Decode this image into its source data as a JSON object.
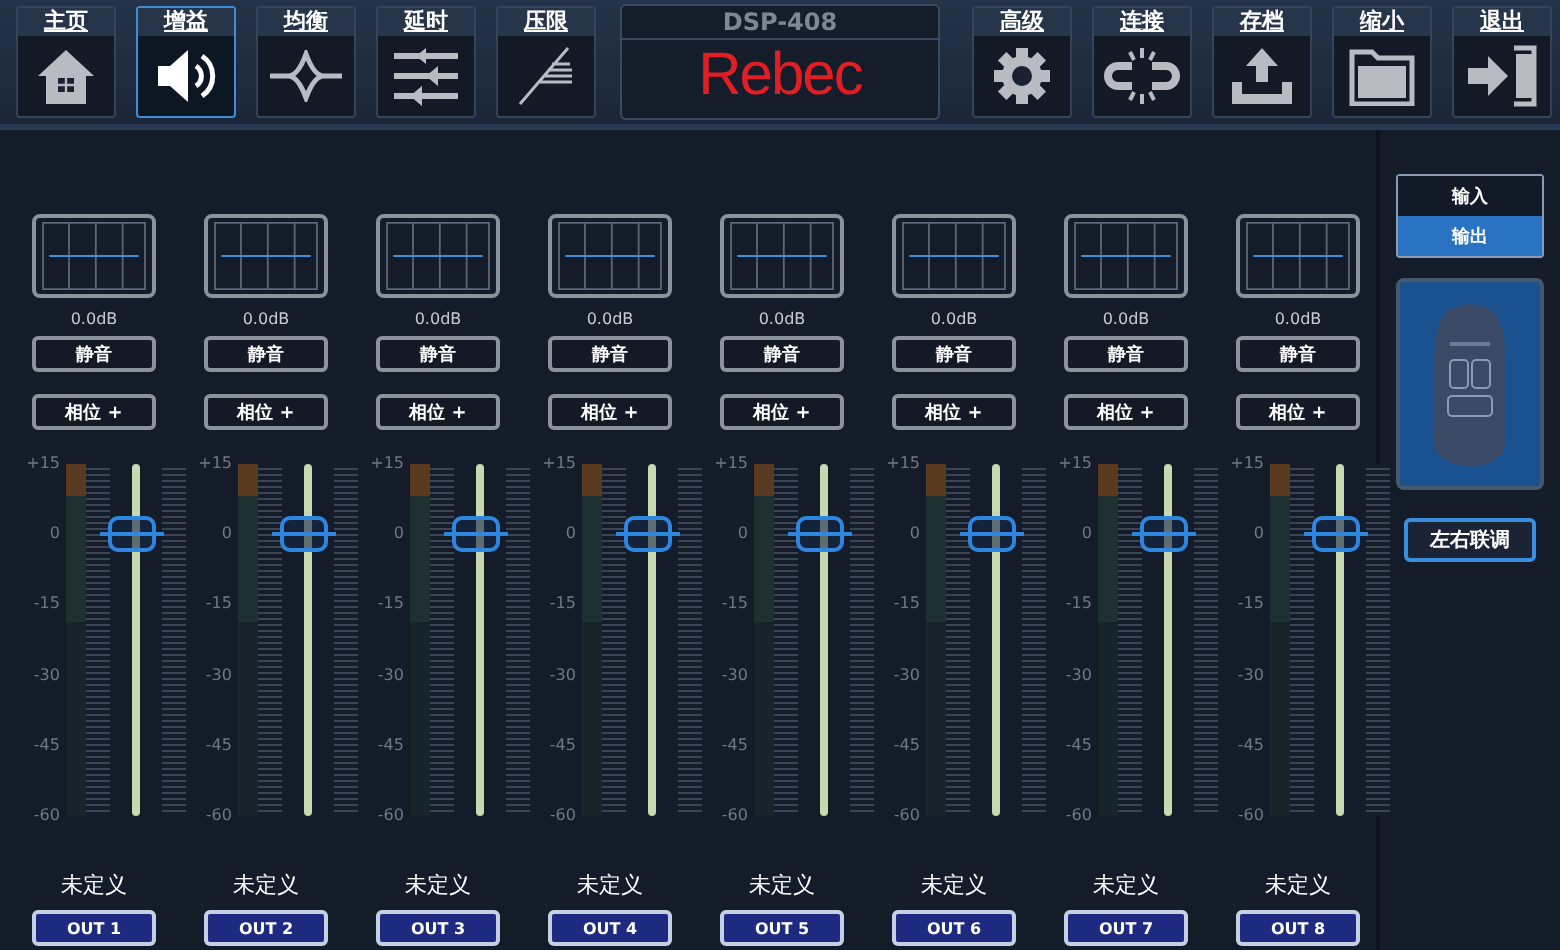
{
  "nav_left": [
    {
      "label": "主页",
      "kind": "home",
      "selected": false
    },
    {
      "label": "增益",
      "kind": "speaker",
      "selected": true
    },
    {
      "label": "均衡",
      "kind": "eq",
      "selected": false
    },
    {
      "label": "延时",
      "kind": "delay",
      "selected": false
    },
    {
      "label": "压限",
      "kind": "limiter",
      "selected": false
    }
  ],
  "device": {
    "model": "DSP-408",
    "brand": "Rebec"
  },
  "nav_right": [
    {
      "label": "高级",
      "kind": "gear",
      "selected": false
    },
    {
      "label": "连接",
      "kind": "link",
      "selected": false
    },
    {
      "label": "存档",
      "kind": "upload",
      "selected": false
    },
    {
      "label": "缩小",
      "kind": "folder",
      "selected": false
    },
    {
      "label": "退出",
      "kind": "exit",
      "selected": false
    }
  ],
  "channels": [
    {
      "gain": "0.0dB",
      "mute": "静音",
      "phase": "相位 +",
      "scale": [
        "+15",
        "0",
        "-15",
        "-30",
        "-45",
        "-60"
      ],
      "level": 0.8,
      "name": "未定义",
      "output": "OUT 1"
    },
    {
      "gain": "0.0dB",
      "mute": "静音",
      "phase": "相位 +",
      "scale": [
        "+15",
        "0",
        "-15",
        "-30",
        "-45",
        "-60"
      ],
      "level": 0.8,
      "name": "未定义",
      "output": "OUT 2"
    },
    {
      "gain": "0.0dB",
      "mute": "静音",
      "phase": "相位 +",
      "scale": [
        "+15",
        "0",
        "-15",
        "-30",
        "-45",
        "-60"
      ],
      "level": 0.8,
      "name": "未定义",
      "output": "OUT 3"
    },
    {
      "gain": "0.0dB",
      "mute": "静音",
      "phase": "相位 +",
      "scale": [
        "+15",
        "0",
        "-15",
        "-30",
        "-45",
        "-60"
      ],
      "level": 0.8,
      "name": "未定义",
      "output": "OUT 4"
    },
    {
      "gain": "0.0dB",
      "mute": "静音",
      "phase": "相位 +",
      "scale": [
        "+15",
        "0",
        "-15",
        "-30",
        "-45",
        "-60"
      ],
      "level": 0.8,
      "name": "未定义",
      "output": "OUT 5"
    },
    {
      "gain": "0.0dB",
      "mute": "静音",
      "phase": "相位 +",
      "scale": [
        "+15",
        "0",
        "-15",
        "-30",
        "-45",
        "-60"
      ],
      "level": 0.8,
      "name": "未定义",
      "output": "OUT 6"
    },
    {
      "gain": "0.0dB",
      "mute": "静音",
      "phase": "相位 +",
      "scale": [
        "+15",
        "0",
        "-15",
        "-30",
        "-45",
        "-60"
      ],
      "level": 0.8,
      "name": "未定义",
      "output": "OUT 7"
    },
    {
      "gain": "0.0dB",
      "mute": "静音",
      "phase": "相位 +",
      "scale": [
        "+15",
        "0",
        "-15",
        "-30",
        "-45",
        "-60"
      ],
      "level": 0.8,
      "name": "未定义",
      "output": "OUT 8"
    }
  ],
  "side_panel": {
    "tabs": [
      {
        "label": "输入",
        "selected": false
      },
      {
        "label": "输出",
        "selected": true
      }
    ],
    "link_button": "左右联调"
  }
}
